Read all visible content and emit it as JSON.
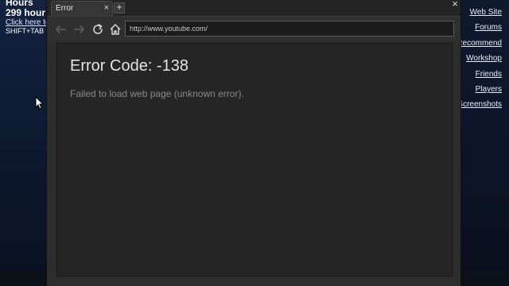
{
  "overlay": {
    "line1": "Hours",
    "hours_text": "299 hour",
    "link_text": "Click here to",
    "hint_text": "SHIFT+TAB"
  },
  "browser": {
    "tab_title": "Error",
    "tab_close": "×",
    "new_tab": "+",
    "window_close": "×",
    "url": "http://www.youtube.com/"
  },
  "page": {
    "error_title": "Error Code: -138",
    "error_message": "Failed to load web page (unknown error)."
  },
  "side_links": [
    "Web Site",
    "Forums",
    "Recommend",
    "Workshop",
    "Friends",
    "Players",
    "Screenshots"
  ],
  "colors": {
    "browser_bg": "#2d2d2d",
    "content_bg": "#262626",
    "title_text": "#e4e4e4",
    "message_text": "#8a8a8a"
  },
  "icons": [
    "back-icon",
    "forward-icon",
    "reload-icon",
    "home-icon",
    "mouse-cursor-icon"
  ]
}
